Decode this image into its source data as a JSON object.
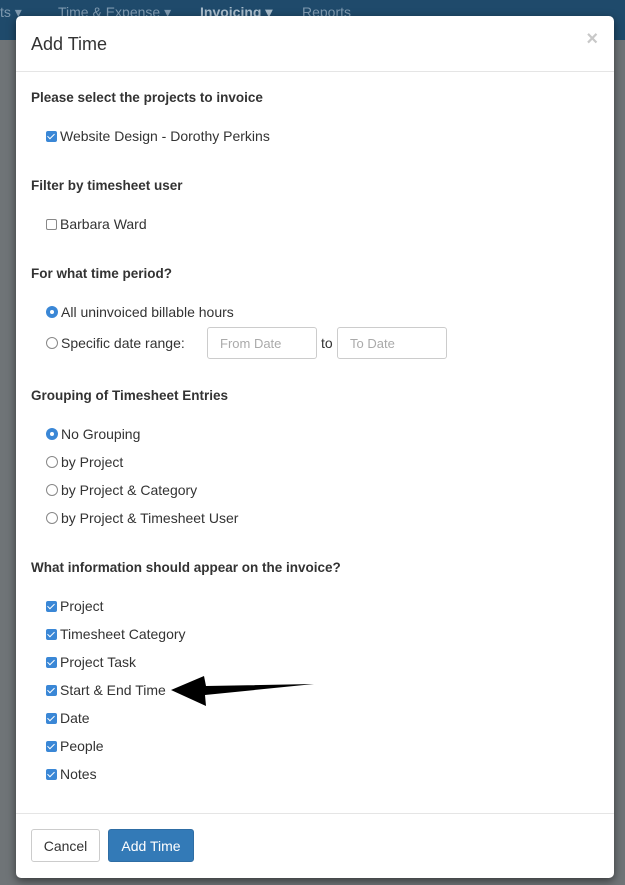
{
  "nav": {
    "items": [
      "ts ▾",
      "Time & Expense ▾",
      "Invoicing ▾",
      "Reports"
    ]
  },
  "modal": {
    "title": "Add Time",
    "close": "×",
    "projects": {
      "heading": "Please select the projects to invoice",
      "items": [
        {
          "label": "Website Design - Dorothy Perkins",
          "checked": true
        }
      ]
    },
    "users": {
      "heading": "Filter by timesheet user",
      "items": [
        {
          "label": "Barbara Ward",
          "checked": false
        }
      ]
    },
    "period": {
      "heading": "For what time period?",
      "options": [
        {
          "label": "All uninvoiced billable hours",
          "selected": true
        },
        {
          "label": "Specific date range:",
          "selected": false
        }
      ],
      "from_placeholder": "From Date",
      "to_label": "to",
      "to_placeholder": "To Date"
    },
    "grouping": {
      "heading": "Grouping of Timesheet Entries",
      "options": [
        {
          "label": "No Grouping",
          "selected": true
        },
        {
          "label": "by Project",
          "selected": false
        },
        {
          "label": "by Project & Category",
          "selected": false
        },
        {
          "label": "by Project & Timesheet User",
          "selected": false
        }
      ]
    },
    "info": {
      "heading": "What information should appear on the invoice?",
      "items": [
        {
          "label": "Project",
          "checked": true
        },
        {
          "label": "Timesheet Category",
          "checked": true
        },
        {
          "label": "Project Task",
          "checked": true
        },
        {
          "label": "Start & End Time",
          "checked": true
        },
        {
          "label": "Date",
          "checked": true
        },
        {
          "label": "People",
          "checked": true
        },
        {
          "label": "Notes",
          "checked": true
        }
      ]
    },
    "footer": {
      "cancel": "Cancel",
      "submit": "Add Time"
    }
  },
  "colors": {
    "accent": "#337ab7",
    "checkbox": "#3a87d6",
    "nav": "#1f4a6b"
  }
}
